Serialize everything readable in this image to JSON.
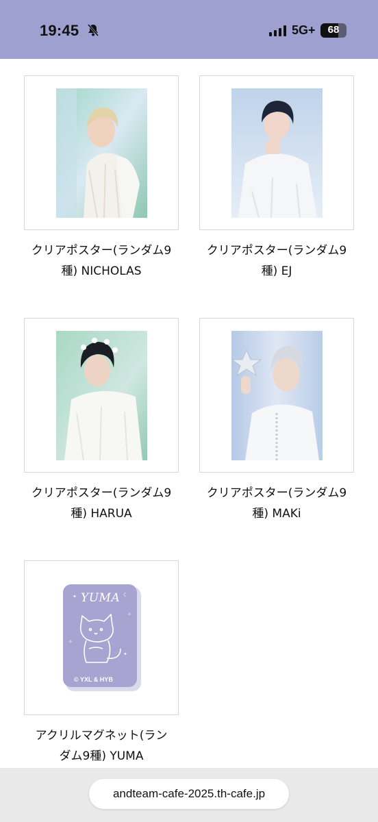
{
  "status_bar": {
    "time": "19:45",
    "network": "5G+",
    "battery_level": 68,
    "battery_label": "68",
    "background": "#9ea0cf"
  },
  "products": [
    {
      "title_line1": "クリアポスター(ランダム9",
      "title_line2": "種) NICHOLAS"
    },
    {
      "title_line1": "クリアポスター(ランダム9",
      "title_line2": "種) EJ"
    },
    {
      "title_line1": "クリアポスター(ランダム9",
      "title_line2": "種) HARUA"
    },
    {
      "title_line1": "クリアポスター(ランダム9",
      "title_line2": "種) MAKi"
    },
    {
      "title_line1": "アクリルマグネット(ラン",
      "title_line2": "ダム9種) YUMA"
    }
  ],
  "magnet": {
    "name_text": "YUMA",
    "copyright": "© YXL & HYB",
    "color": "#a7a4d2"
  },
  "browser": {
    "url": "andteam-cafe-2025.th-cafe.jp"
  }
}
